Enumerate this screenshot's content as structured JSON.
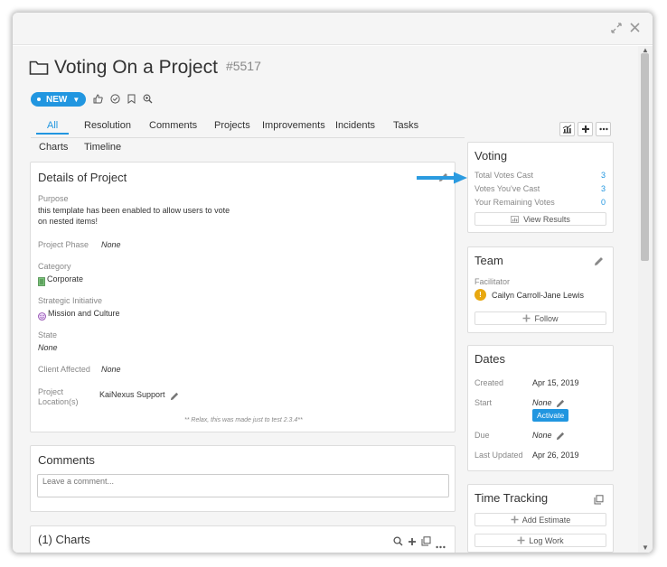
{
  "window": {
    "expand_icon": "expand-icon",
    "close_icon": "close-icon"
  },
  "header": {
    "title": "Voting On a Project",
    "ticket_number": "#5517",
    "status": "NEW"
  },
  "tabs_row1": [
    "All",
    "Resolution",
    "Comments",
    "Projects",
    "Improvements",
    "Incidents",
    "Tasks"
  ],
  "tabs_row2": [
    "Charts",
    "Timeline"
  ],
  "details": {
    "heading": "Details of Project",
    "purpose_label": "Purpose",
    "purpose_line1": "this template has been enabled to allow users to vote",
    "purpose_line2": "on nested items!",
    "phase_label": "Project Phase",
    "phase_value": "None",
    "category_label": "Category",
    "category_value": "Corporate",
    "initiative_label": "Strategic Initiative",
    "initiative_value": "Mission and Culture",
    "state_label": "State",
    "state_value": "None",
    "client_label": "Client Affected",
    "client_value": "None",
    "location_label_1": "Project",
    "location_label_2": "Location(s)",
    "location_value": "KaiNexus Support",
    "footnote": "** Relax, this was made just to test 2.3.4**"
  },
  "comments": {
    "heading": "Comments",
    "placeholder": "Leave a comment..."
  },
  "charts": {
    "heading": "(1) Charts",
    "row_count": "1"
  },
  "voting": {
    "heading": "Voting",
    "rows": [
      {
        "label": "Total Votes Cast",
        "value": "3"
      },
      {
        "label": "Votes You've Cast",
        "value": "3"
      },
      {
        "label": "Your Remaining Votes",
        "value": "0"
      }
    ],
    "button": "View Results"
  },
  "team": {
    "heading": "Team",
    "facilitator_label": "Facilitator",
    "facilitator_name": "Cailyn Carroll-Jane Lewis",
    "follow_button": "Follow"
  },
  "dates": {
    "heading": "Dates",
    "created_label": "Created",
    "created_value": "Apr 15, 2019",
    "start_label": "Start",
    "start_value": "None",
    "activate_button": "Activate",
    "due_label": "Due",
    "due_value": "None",
    "updated_label": "Last Updated",
    "updated_value": "Apr 26, 2019"
  },
  "time_tracking": {
    "heading": "Time Tracking",
    "add_estimate": "Add Estimate",
    "log_work": "Log Work"
  },
  "colors": {
    "accent": "#2196e0",
    "arrow": "#2b9be0"
  }
}
